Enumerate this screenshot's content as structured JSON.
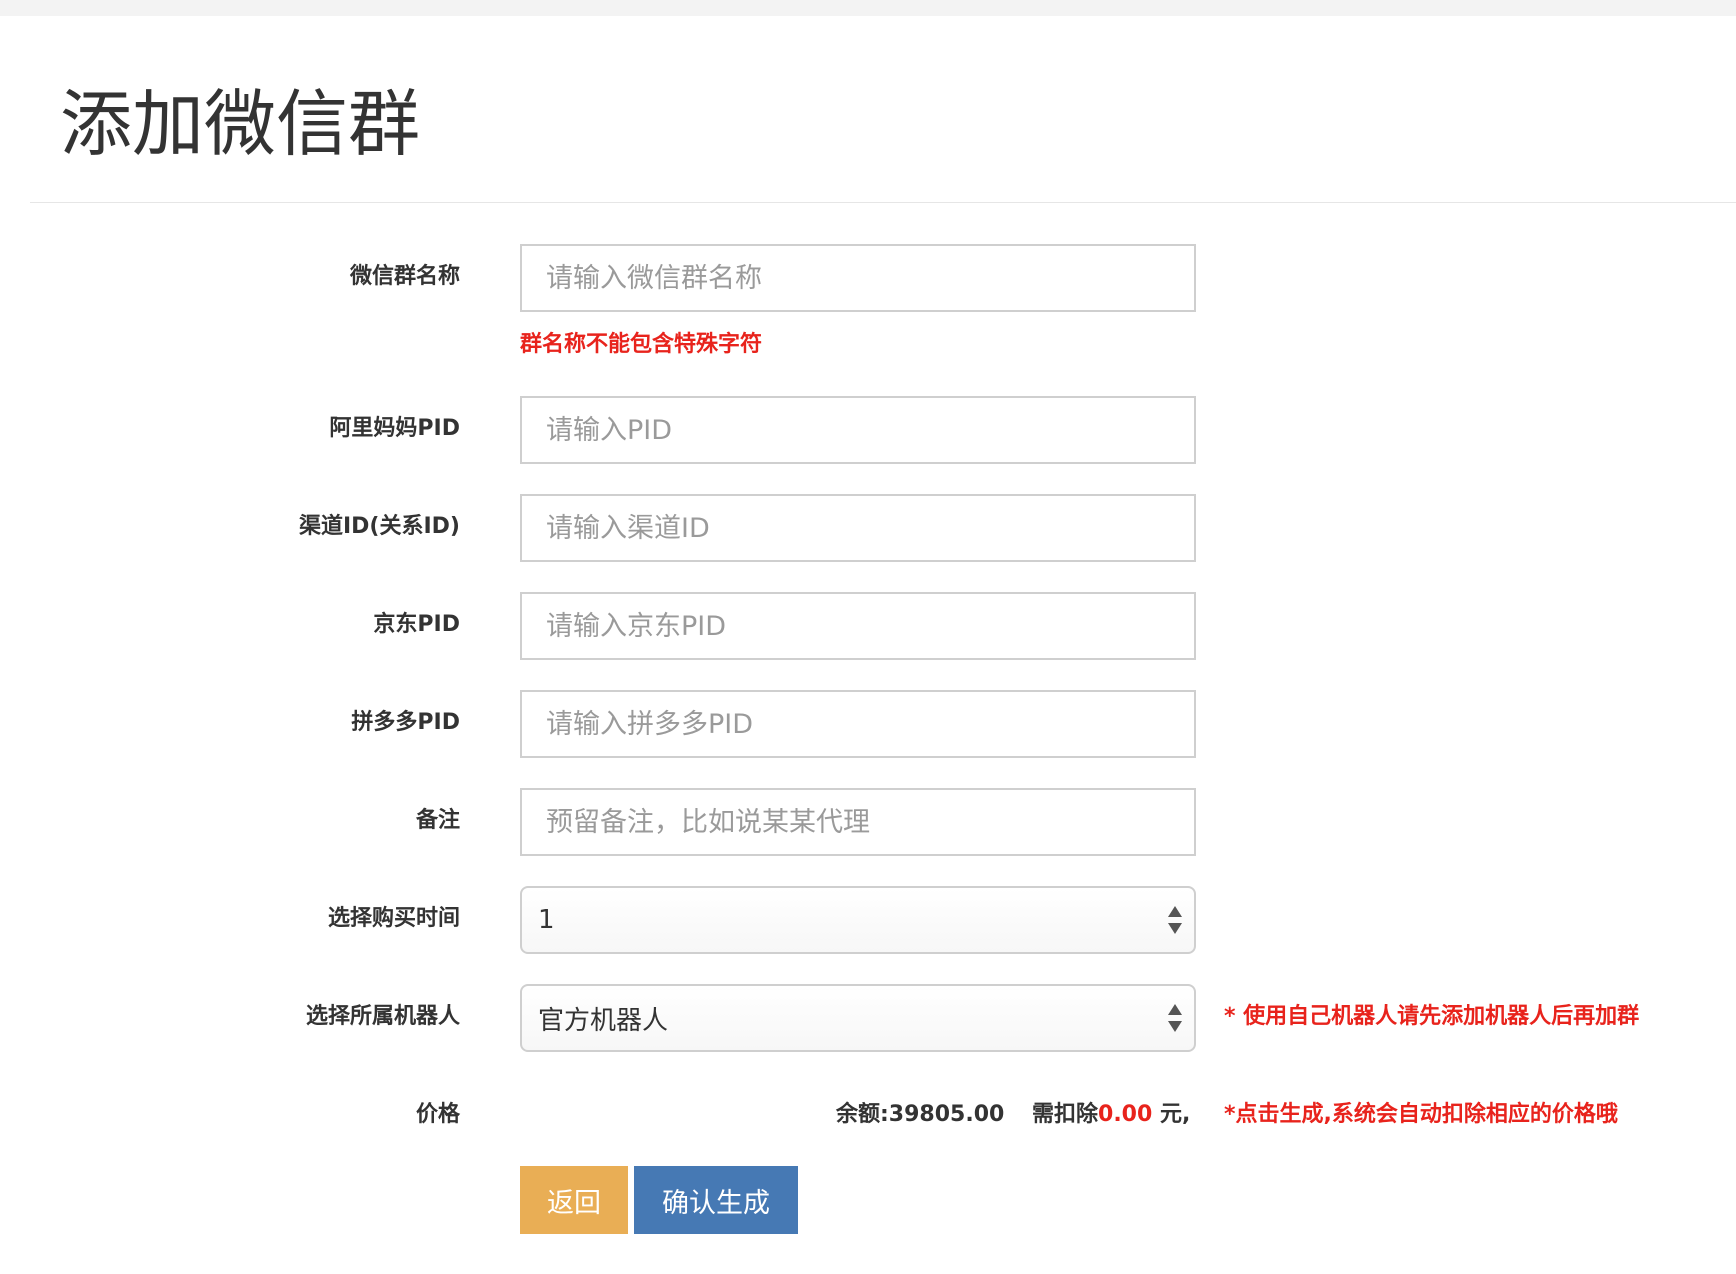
{
  "page": {
    "title": "添加微信群"
  },
  "form": {
    "group_name": {
      "label": "微信群名称",
      "placeholder": "请输入微信群名称",
      "hint": "群名称不能包含特殊字符"
    },
    "alimama_pid": {
      "label": "阿里妈妈PID",
      "placeholder": "请输入PID"
    },
    "channel_id": {
      "label": "渠道ID(关系ID)",
      "placeholder": "请输入渠道ID"
    },
    "jd_pid": {
      "label": "京东PID",
      "placeholder": "请输入京东PID"
    },
    "pdd_pid": {
      "label": "拼多多PID",
      "placeholder": "请输入拼多多PID"
    },
    "remark": {
      "label": "备注",
      "placeholder": "预留备注，比如说某某代理"
    },
    "duration": {
      "label": "选择购买时间",
      "value": "1"
    },
    "robot": {
      "label": "选择所属机器人",
      "value": "官方机器人",
      "hint": "* 使用自己机器人请先添加机器人后再加群"
    },
    "price": {
      "label": "价格",
      "balance": "余额:39805.00",
      "deduct_prefix": "需扣除",
      "deduct_amount": "0.00",
      "deduct_suffix": " 元,",
      "hint": "*点击生成,系统会自动扣除相应的价格哦"
    }
  },
  "buttons": {
    "back": "返回",
    "confirm": "确认生成"
  },
  "colors": {
    "error_red": "#e8231c",
    "back_button": "#e9ae55",
    "confirm_button": "#4679b4"
  }
}
